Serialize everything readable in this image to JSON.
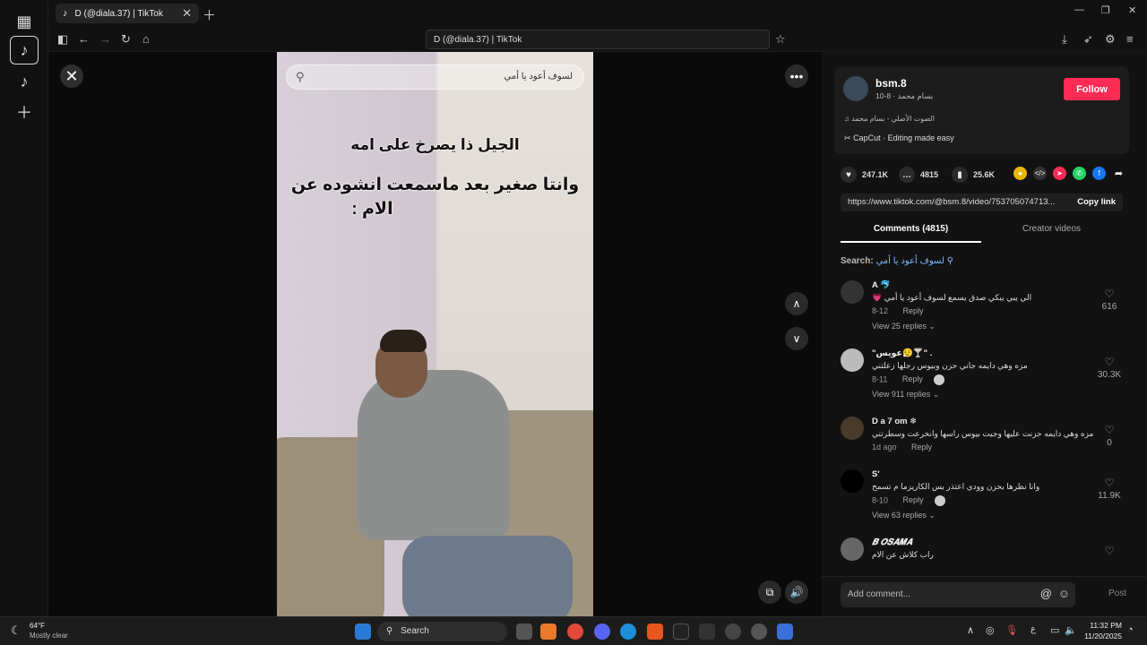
{
  "browser": {
    "tab_title": "D (@diala.37) | TikTok",
    "url_text": "D (@diala.37) | TikTok"
  },
  "video": {
    "search_text": "لسوف أعود يا أمي",
    "caption_line1": "الجيل ذا يصرخ على امه",
    "caption_line2": "وانتا صغير بعد ماسمعت انشوده عن",
    "caption_line3": "الام :"
  },
  "creator": {
    "username": "bsm.8",
    "display_name": "بسام محمد",
    "date": "8-10",
    "sound": "الصوت الأصلي - بسام محمد",
    "capcut": "CapCut · Editing made easy",
    "follow_label": "Follow"
  },
  "stats": {
    "likes": "247.1K",
    "comments": "4815",
    "saves": "25.6K"
  },
  "link": {
    "url": "https://www.tiktok.com/@bsm.8/video/753705074713...",
    "copy_label": "Copy link"
  },
  "tabs": {
    "comments": "Comments (4815)",
    "creator_videos": "Creator videos"
  },
  "search_row": {
    "label": "Search:",
    "query": "لسوف أعود يا أمي"
  },
  "comments": [
    {
      "name": "A 🐬",
      "text": "الي يبي يبكي صدق يسمع لسوف أعود يا أمي 💗",
      "date": "8-12",
      "reply": "Reply",
      "likes": "616",
      "replies": "View 25 replies ⌄"
    },
    {
      "name": "\"عويس😮‍💨🍸\" .",
      "text": "مزه وهي دايمه جاني حزن وبيوس رجلها زعلتني",
      "date": "8-11",
      "reply": "Reply",
      "likes": "30.3K",
      "replies": "View 911 replies ⌄"
    },
    {
      "name": "D a 7 om ❄",
      "text": "مزه وهي دايمه حزنت عليها وجيت بيوس راسها وانخرعت وسطرتني",
      "date": "1d ago",
      "reply": "Reply",
      "likes": "0",
      "replies": ""
    },
    {
      "name": "S'",
      "text": "وانا نظرها بحزن وودي اعتذر بس الكاريزما م تسمح",
      "date": "8-10",
      "reply": "Reply",
      "likes": "11.9K",
      "replies": "View 63 replies ⌄"
    },
    {
      "name": "𝑩 𝑶𝑺𝑨𝑴𝑨",
      "text": "راب كلاش عن الام",
      "date": "",
      "reply": "",
      "likes": "",
      "replies": ""
    }
  ],
  "add_comment": {
    "placeholder": "Add comment...",
    "post_label": "Post"
  },
  "taskbar": {
    "temp": "64°F",
    "weather": "Mostly clear",
    "search": "Search",
    "time": "11:32 PM",
    "date": "11/20/2025"
  }
}
